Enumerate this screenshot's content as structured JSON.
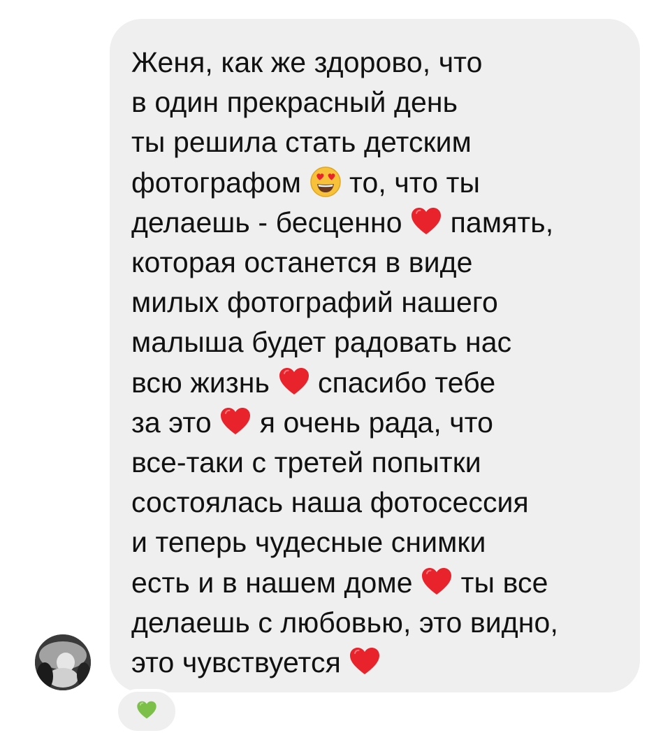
{
  "message": {
    "lines": [
      "Женя, как же здорово, что",
      "в один прекрасный день",
      "ты решила стать детским",
      "фотографом",
      "то, что ты",
      "делаешь - бесценно",
      "память,",
      "которая останется в виде",
      "милых фотографий нашего",
      "малыша будет радовать нас",
      "всю жизнь",
      "спасибо тебе",
      "за это",
      "я очень рада, что",
      "все-таки с третей попытки",
      "состоялась наша фотосессия",
      "и теперь чудесные снимки",
      "есть и в нашем доме",
      "ты все",
      "делаешь с любовью, это видно,",
      "это чувствуется"
    ]
  },
  "emojis": {
    "heart_eyes": "smiling-face-with-heart-eyes-icon",
    "red_heart": "red-heart-icon",
    "green_heart": "green-heart-icon"
  },
  "reaction": {
    "icon": "green-heart-icon"
  },
  "colors": {
    "bubble_bg": "#efefef",
    "text": "#111111",
    "red_heart": "#e8232b",
    "green_heart": "#7cc04a"
  }
}
